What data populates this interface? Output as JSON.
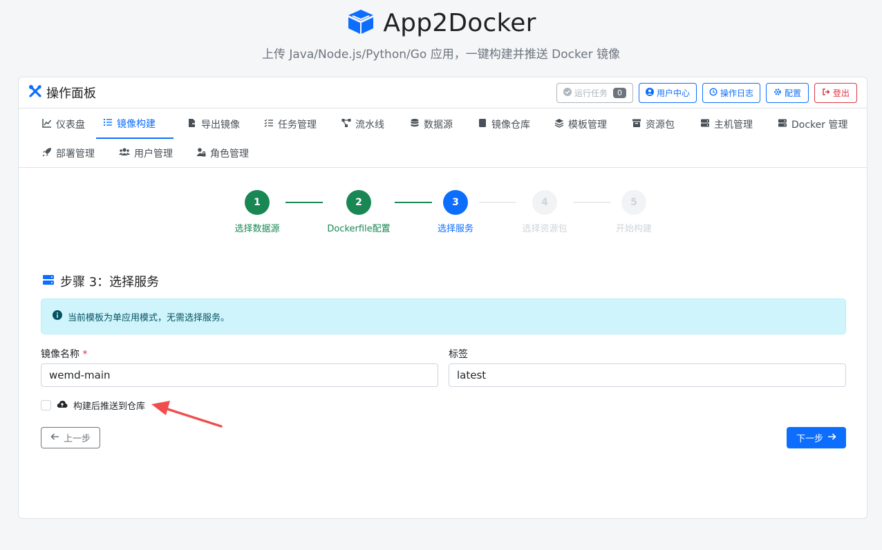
{
  "header": {
    "app_title": "App2Docker",
    "subtitle": "上传 Java/Node.js/Python/Go 应用，一键构建并推送 Docker 镜像",
    "logo_icon": "box-icon",
    "brand_color": "#0d6efd"
  },
  "panel": {
    "title": "操作面板",
    "actions": {
      "running_tasks_label": "运行任务",
      "running_tasks_count": "0",
      "user_center_label": "用户中心",
      "op_log_label": "操作日志",
      "config_label": "配置",
      "logout_label": "登出"
    }
  },
  "tabs": [
    {
      "label": "仪表盘",
      "icon": "chart-line-icon"
    },
    {
      "label": "镜像构建",
      "icon": "list-ol-icon",
      "active": true
    },
    {
      "label": "导出镜像",
      "icon": "file-export-icon"
    },
    {
      "label": "任务管理",
      "icon": "tasks-icon"
    },
    {
      "label": "流水线",
      "icon": "project-diagram-icon"
    },
    {
      "label": "数据源",
      "icon": "database-icon"
    },
    {
      "label": "镜像仓库",
      "icon": "archive-icon"
    },
    {
      "label": "模板管理",
      "icon": "layer-group-icon"
    },
    {
      "label": "资源包",
      "icon": "box-archive-icon"
    },
    {
      "label": "主机管理",
      "icon": "server-icon"
    },
    {
      "label": "Docker 管理",
      "icon": "docker-icon"
    },
    {
      "label": "部署管理",
      "icon": "rocket-icon"
    },
    {
      "label": "用户管理",
      "icon": "users-icon"
    },
    {
      "label": "角色管理",
      "icon": "user-lock-icon"
    }
  ],
  "stepper": {
    "steps": [
      {
        "number": "1",
        "label": "选择数据源",
        "state": "done"
      },
      {
        "number": "2",
        "label": "Dockerfile配置",
        "state": "done"
      },
      {
        "number": "3",
        "label": "选择服务",
        "state": "current"
      },
      {
        "number": "4",
        "label": "选择资源包",
        "state": "todo"
      },
      {
        "number": "5",
        "label": "开始构建",
        "state": "todo"
      }
    ],
    "colors": {
      "done": "#198754",
      "current": "#0d6efd",
      "todo": "#ced4da"
    }
  },
  "section": {
    "title": "步骤 3：选择服务"
  },
  "alert": {
    "text": "当前模板为单应用模式，无需选择服务。",
    "color": "#cff4fc"
  },
  "form": {
    "image_name_label": "镜像名称",
    "required_mark": "*",
    "image_name_value": "wemd-main",
    "tag_label": "标签",
    "tag_value": "latest",
    "push_label": "构建后推送到仓库",
    "push_checked": false
  },
  "buttons": {
    "prev_label": "上一步",
    "next_label": "下一步"
  },
  "annotation": {
    "arrow_color": "#f04e4e"
  }
}
